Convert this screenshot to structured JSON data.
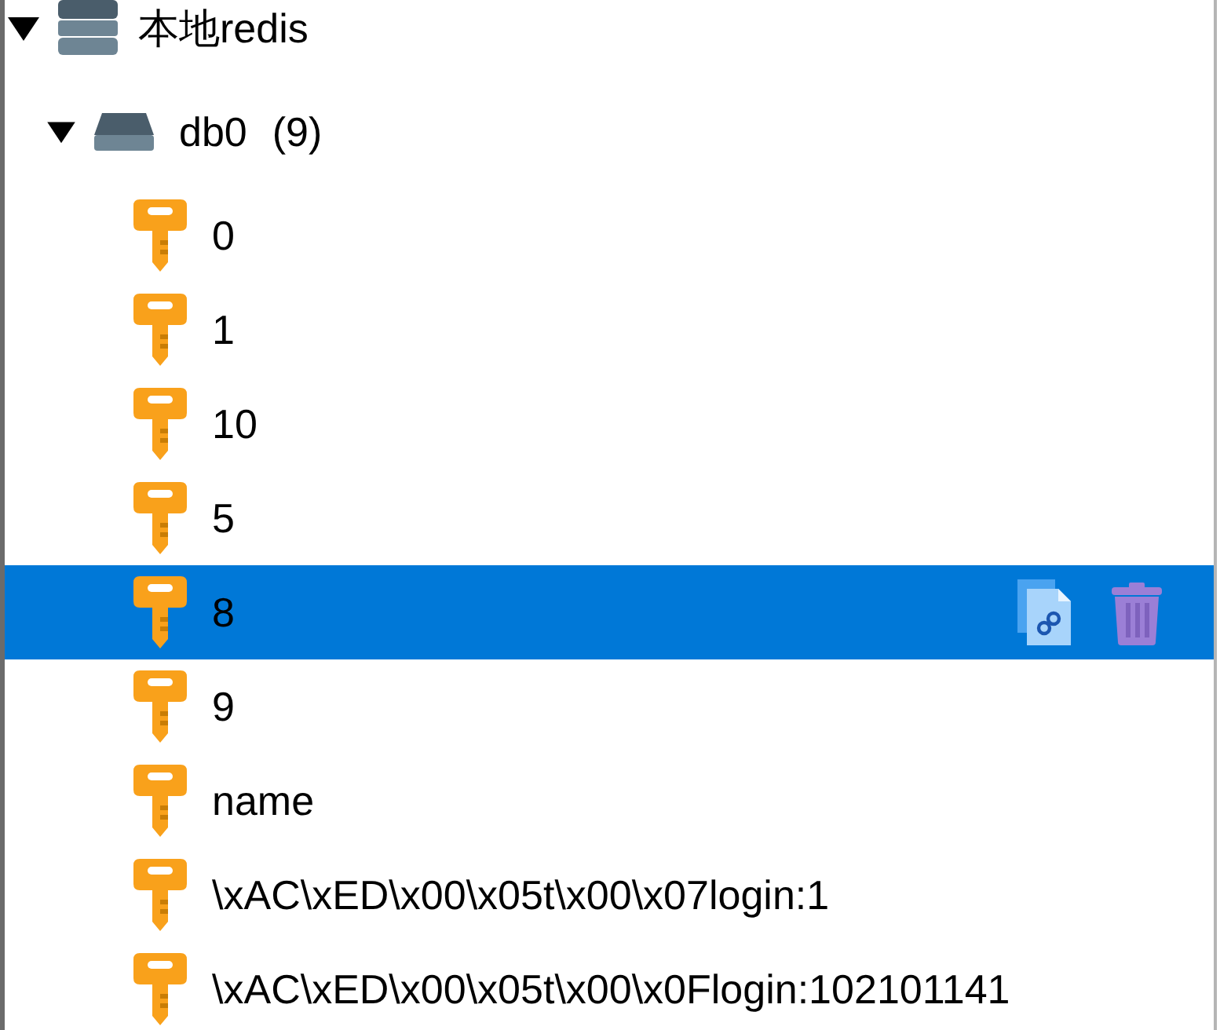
{
  "tree": {
    "name": "本地redis",
    "expanded": true,
    "children": [
      {
        "name": "db0",
        "count": "(9)",
        "expanded": true,
        "children": [
          {
            "name": "0",
            "selected": false
          },
          {
            "name": "1",
            "selected": false
          },
          {
            "name": "10",
            "selected": false
          },
          {
            "name": "5",
            "selected": false
          },
          {
            "name": "8",
            "selected": true
          },
          {
            "name": "9",
            "selected": false
          },
          {
            "name": "name",
            "selected": false
          },
          {
            "name": "\\xAC\\xED\\x00\\x05t\\x00\\x07login:1",
            "selected": false
          },
          {
            "name": "\\xAC\\xED\\x00\\x05t\\x00\\x0Flogin:102101141",
            "selected": false
          }
        ]
      }
    ]
  }
}
